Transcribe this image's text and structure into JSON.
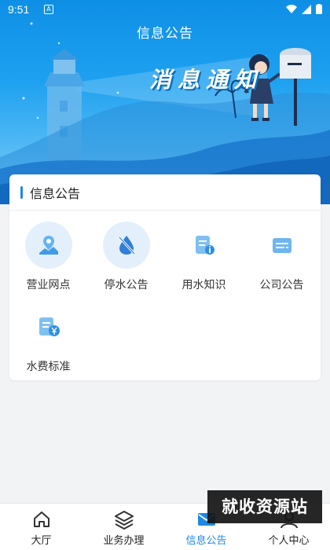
{
  "status_bar": {
    "time": "9:51",
    "notification_glyph": "A"
  },
  "header": {
    "title": "信息公告"
  },
  "hero": {
    "banner_text": "消息通知"
  },
  "card": {
    "title": "信息公告",
    "items": [
      {
        "label": "营业网点",
        "icon": "location-map-icon"
      },
      {
        "label": "停水公告",
        "icon": "water-off-icon"
      },
      {
        "label": "用水知识",
        "icon": "document-info-icon"
      },
      {
        "label": "公司公告",
        "icon": "notice-card-icon"
      },
      {
        "label": "水费标准",
        "icon": "fee-yuan-icon"
      }
    ]
  },
  "bottom_nav": {
    "items": [
      {
        "label": "大厅",
        "icon": "home-icon"
      },
      {
        "label": "业务办理",
        "icon": "layers-icon"
      },
      {
        "label": "信息公告",
        "icon": "mail-icon",
        "active": true
      },
      {
        "label": "个人中心",
        "icon": "user-icon"
      }
    ]
  },
  "watermark": {
    "text": "就收资源站"
  },
  "colors": {
    "accent": "#1e88e5",
    "hero_blue": "#1ea1f0"
  }
}
